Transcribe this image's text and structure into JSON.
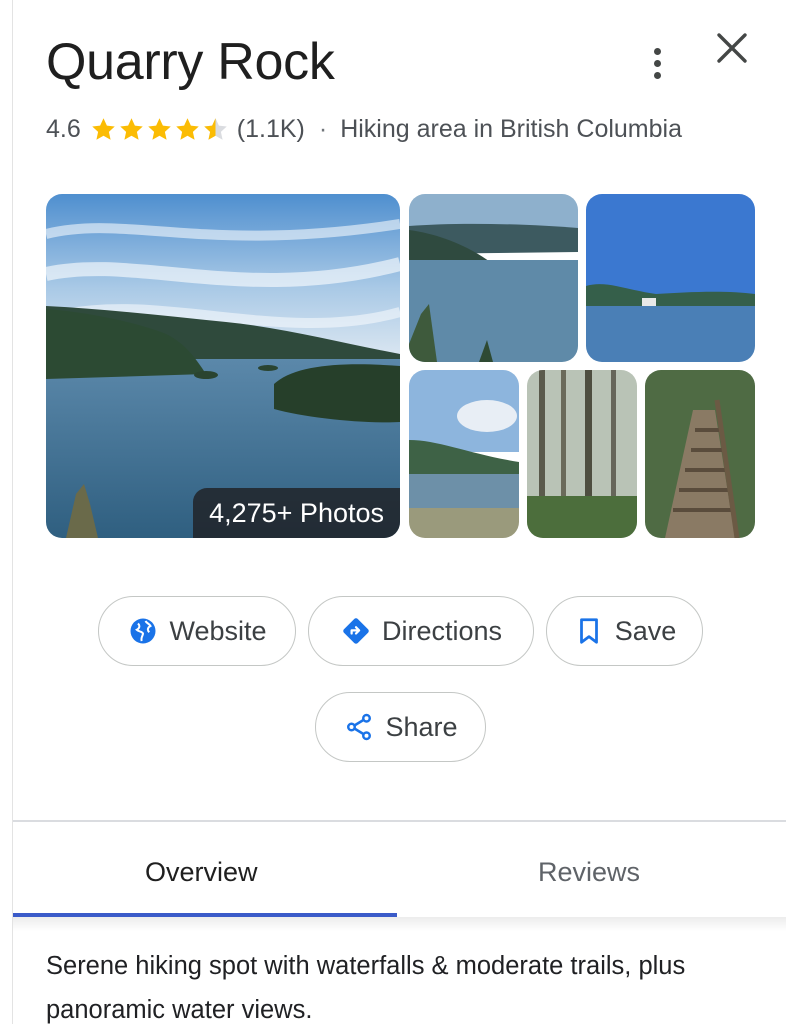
{
  "place": {
    "title": "Quarry Rock",
    "rating": "4.6",
    "rating_value": 4.6,
    "stars_max": 5,
    "review_count": "(1.1K)",
    "separator": "·",
    "category": "Hiking area in British Columbia"
  },
  "header_icons": {
    "more": "more-vert-icon",
    "close": "close-icon"
  },
  "photos": {
    "count_label": "4,275+ Photos"
  },
  "actions": {
    "website": {
      "label": "Website",
      "icon": "globe-icon"
    },
    "directions": {
      "label": "Directions",
      "icon": "directions-icon"
    },
    "save": {
      "label": "Save",
      "icon": "bookmark-icon"
    },
    "share": {
      "label": "Share",
      "icon": "share-icon"
    }
  },
  "tabs": [
    {
      "label": "Overview",
      "active": true
    },
    {
      "label": "Reviews",
      "active": false
    }
  ],
  "description": "Serene hiking spot with waterfalls & moderate trails, plus panoramic water views.",
  "colors": {
    "accent": "#1a73e8",
    "star": "#fbbc04",
    "tab_indicator": "#3b5bc9"
  }
}
